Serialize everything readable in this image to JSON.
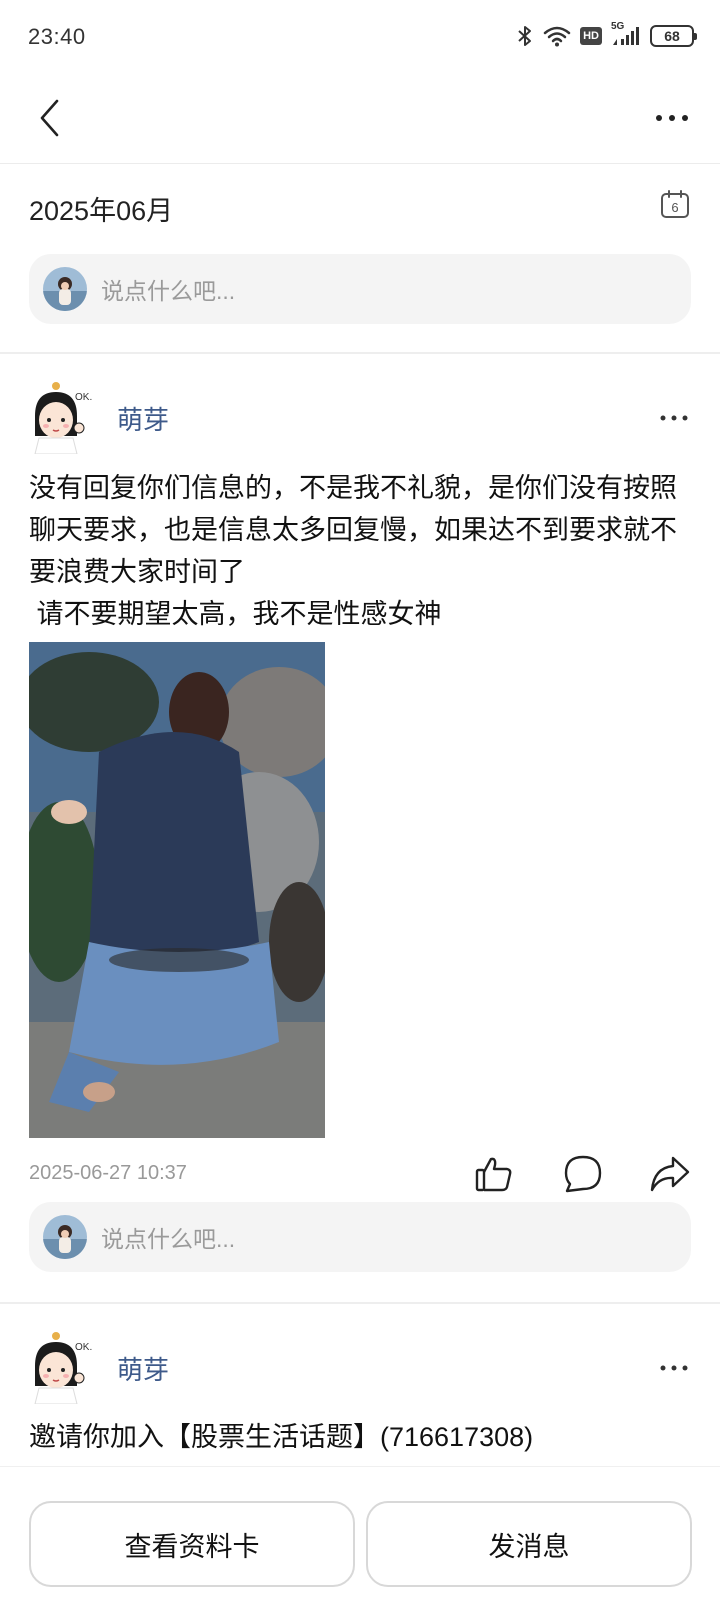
{
  "status_bar": {
    "time": "23:40",
    "network": "5G",
    "hd_label": "HD",
    "battery": "68",
    "icons": [
      "bluetooth-icon",
      "wifi-icon",
      "hd-icon",
      "signal-icon",
      "battery-icon"
    ]
  },
  "nav": {
    "back_icon": "chevron-left-icon",
    "more_icon": "more-horizontal-icon"
  },
  "month": {
    "label": "2025年06月",
    "calendar_day": "6"
  },
  "comment_box": {
    "placeholder": "说点什么吧..."
  },
  "posts": [
    {
      "author": "萌芽",
      "text": "没有回复你们信息的，不是我不礼貌，是你们没有按照聊天要求，也是信息太多回复慢，如果达不到要求就不要浪费大家时间了\n 请不要期望太高，我不是性感女神",
      "timestamp": "2025-06-27 10:37",
      "actions": [
        "like-icon",
        "comment-icon",
        "share-icon"
      ],
      "comment_placeholder": "说点什么吧..."
    },
    {
      "author": "萌芽",
      "text": "邀请你加入【股票生活话题】(716617308)"
    }
  ],
  "bottom": {
    "view_profile": "查看资料卡",
    "send_message": "发消息"
  },
  "colors": {
    "author_name": "#3e5a8a",
    "placeholder": "#9a9a9a",
    "timestamp": "#999999",
    "comment_bg": "#f4f4f4"
  }
}
